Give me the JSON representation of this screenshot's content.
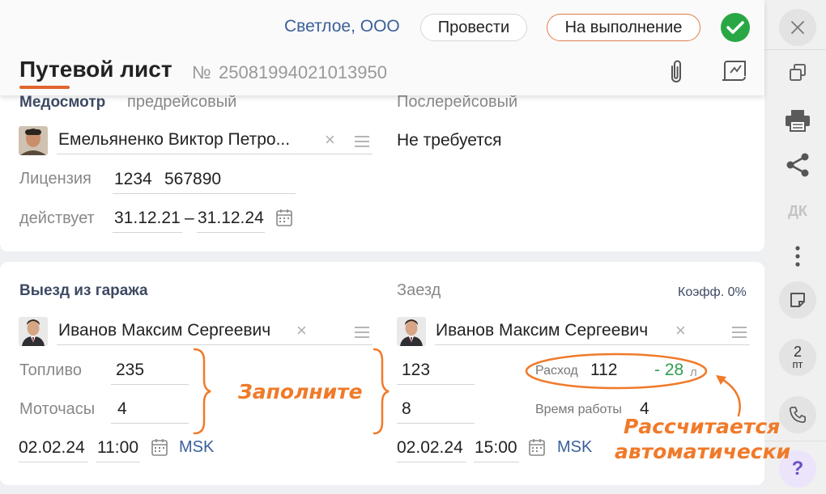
{
  "header": {
    "organization": "Светлое, ООО",
    "post_button": "Провести",
    "execute_button": "На выполнение",
    "title": "Путевой лист",
    "doc_number_label": "№",
    "doc_number": "25081994021013950"
  },
  "medical": {
    "title": "Медосмотр",
    "subtitle": "предрейсовый",
    "post_trip_label": "Послерейсовый",
    "post_trip_value": "Не требуется",
    "driver_name": "Емельяненко Виктор Петро...",
    "license_label": "Лицензия",
    "license_series": "1234",
    "license_number": "567890",
    "valid_label": "действует",
    "valid_from": "31.12.21",
    "valid_dash": "–",
    "valid_to": "31.12.24"
  },
  "garage": {
    "departure_title": "Выезд из гаража",
    "arrival_title": "Заезд",
    "coefficient": "Коэфф. 0%",
    "departure_driver": "Иванов Максим Сергеевич",
    "arrival_driver": "Иванов Максим Сергеевич",
    "fuel_label": "Топливо",
    "fuel_out": "235",
    "fuel_in": "123",
    "hours_label": "Моточасы",
    "hours_out": "4",
    "hours_in": "8",
    "consumption_label": "Расход",
    "consumption_value": "112",
    "consumption_diff": "- 28",
    "consumption_unit": "л",
    "work_time_label": "Время работы",
    "work_time_value": "4",
    "departure_date": "02.02.24",
    "departure_time": "11:00",
    "departure_tz": "MSK",
    "arrival_date": "02.02.24",
    "arrival_time": "15:00",
    "arrival_tz": "MSK"
  },
  "annotations": {
    "fill_in": "Заполните",
    "calculated_line1": "Рассчитается",
    "calculated_line2": "автоматически"
  },
  "sidebar": {
    "dk_label": "ДК",
    "pages_count": "2",
    "pages_unit": "пт",
    "help_label": "?"
  },
  "colors": {
    "accent_orange": "#e0662e",
    "success_green": "#29a745",
    "link_blue": "#3a5f9a",
    "diff_green": "#2e9e4f",
    "annotation_orange": "#f07a2a"
  }
}
